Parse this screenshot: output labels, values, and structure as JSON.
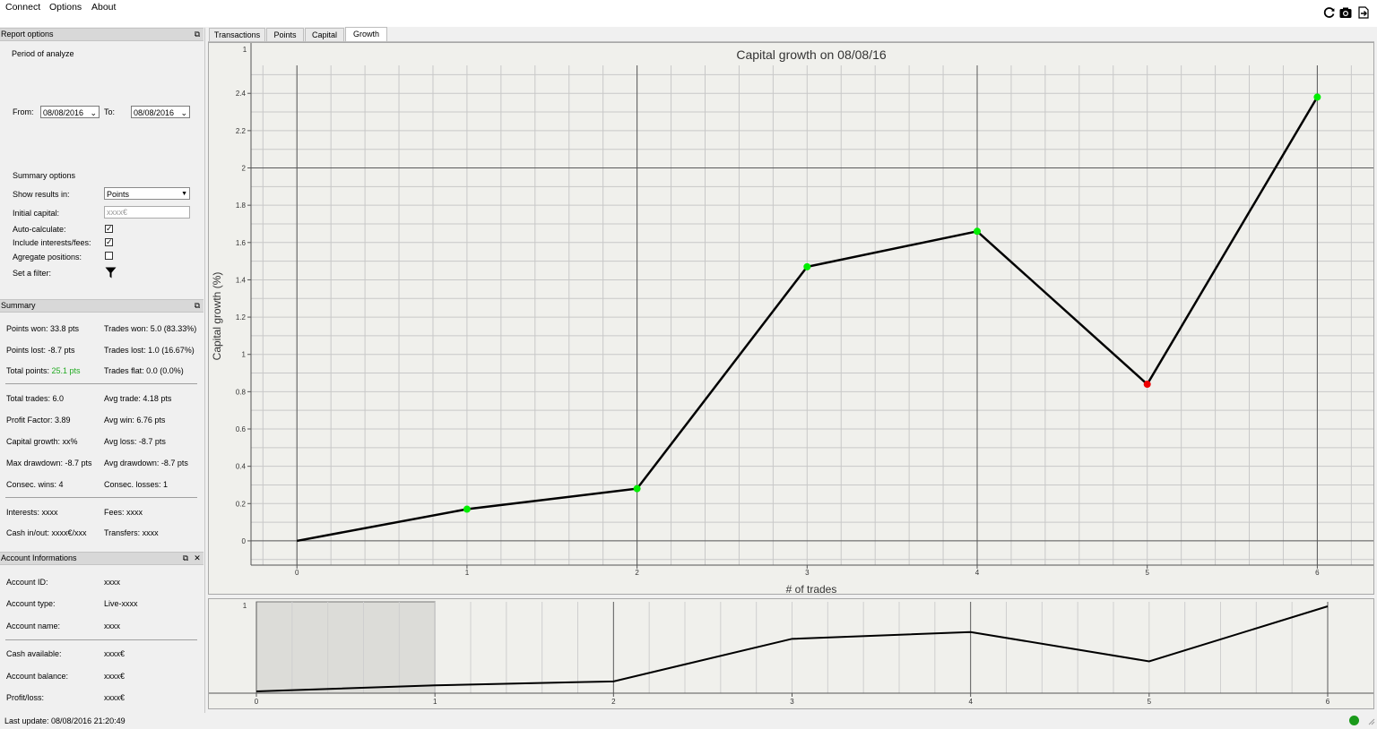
{
  "menu": {
    "items": [
      "Connect",
      "Options",
      "About"
    ]
  },
  "toolbar": {
    "icons": [
      "refresh-icon",
      "camera-icon",
      "export-icon"
    ]
  },
  "report_options": {
    "header": "Report options",
    "period_label": "Period of analyze",
    "from_label": "From:",
    "from_value": "08/08/2016",
    "to_label": "To:",
    "to_value": "08/08/2016",
    "summary_options_label": "Summary options",
    "show_results_label": "Show results in:",
    "show_results_value": "Points",
    "initial_capital_label": "Initial capital:",
    "initial_capital_placeholder": "xxxx€",
    "auto_calculate_label": "Auto-calculate:",
    "auto_calculate": true,
    "include_fees_label": "Include interests/fees:",
    "include_fees": true,
    "aggregate_label": "Agregate positions:",
    "aggregate": false,
    "filter_label": "Set a filter:"
  },
  "summary": {
    "header": "Summary",
    "points_won": "Points won: 33.8 pts",
    "trades_won": "Trades won: 5.0 (83.33%)",
    "points_lost": "Points lost: -8.7 pts",
    "trades_lost": "Trades lost: 1.0 (16.67%)",
    "total_points_label": "Total points: ",
    "total_points_value": "25.1 pts",
    "trades_flat": "Trades flat: 0.0 (0.0%)",
    "total_trades": "Total trades: 6.0",
    "avg_trade": "Avg trade: 4.18 pts",
    "profit_factor": "Profit Factor: 3.89",
    "avg_win": "Avg win: 6.76 pts",
    "capital_growth": "Capital growth: xx%",
    "avg_loss": "Avg loss: -8.7 pts",
    "max_drawdown": "Max drawdown: -8.7 pts",
    "avg_drawdown": "Avg drawdown: -8.7 pts",
    "consec_wins": "Consec. wins: 4",
    "consec_losses": "Consec. losses: 1",
    "interests": "Interests: xxxx",
    "fees": "Fees: xxxx",
    "cash_inout": "Cash in/out: xxxx€/xxx",
    "transfers": "Transfers: xxxx",
    "positive_color": "#22aa22"
  },
  "account": {
    "header": "Account Informations",
    "id_label": "Account ID:",
    "id_value": "xxxx",
    "type_label": "Account type:",
    "type_value": "Live-xxxx",
    "name_label": "Account name:",
    "name_value": "xxxx",
    "cash_label": "Cash available:",
    "cash_value": "xxxx€",
    "balance_label": "Account balance:",
    "balance_value": "xxxx€",
    "pl_label": "Profit/loss:",
    "pl_value": "xxxx€"
  },
  "tabs": [
    {
      "label": "Transactions",
      "active": false
    },
    {
      "label": "Points",
      "active": false
    },
    {
      "label": "Capital",
      "active": false
    },
    {
      "label": "Growth",
      "active": true
    }
  ],
  "status": {
    "last_update": "Last update: 08/08/2016 21:20:49",
    "connection_color": "#1a9a1a"
  },
  "chart_data": {
    "type": "line",
    "title": "Capital growth on 08/08/16",
    "xlabel": "# of trades",
    "ylabel": "Capital growth (%)",
    "x": [
      0,
      1,
      2,
      3,
      4,
      5,
      6
    ],
    "y": [
      0,
      0.17,
      0.28,
      1.47,
      1.66,
      0.84,
      2.38
    ],
    "point_colors": [
      "none",
      "#00ee00",
      "#00ee00",
      "#00ee00",
      "#00ee00",
      "#ee0000",
      "#00ee00"
    ],
    "xlim": [
      -0.27,
      6.33
    ],
    "ylim": [
      -0.13,
      2.55
    ],
    "xticks": [
      0,
      1,
      2,
      3,
      4,
      5,
      6
    ],
    "yticks": [
      0,
      0.2,
      0.4,
      0.6,
      0.8,
      1,
      1.2,
      1.4,
      1.6,
      1.8,
      2,
      2.2,
      2.4
    ],
    "grid": true,
    "corner_label": "1",
    "navigator": {
      "xticks": [
        0,
        1,
        2,
        3,
        4,
        5,
        6
      ],
      "corner_label": "1",
      "selection": [
        0,
        1
      ]
    }
  }
}
